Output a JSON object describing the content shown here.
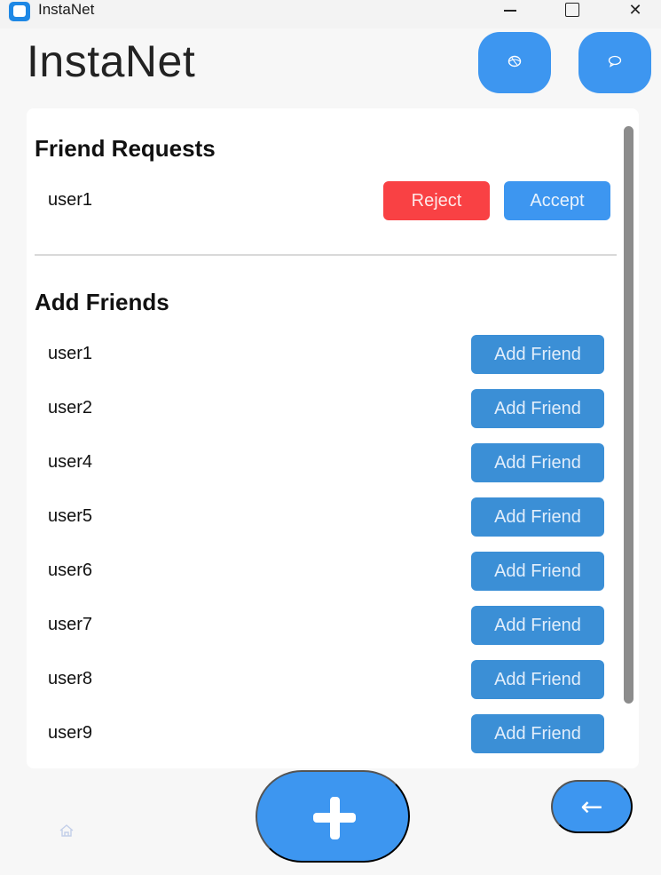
{
  "window": {
    "title": "InstaNet",
    "minimize_icon": "minimize-icon",
    "maximize_icon": "maximize-icon",
    "close_glyph": "✕"
  },
  "header": {
    "title": "InstaNet",
    "globe_button_icon": "globe-icon",
    "chat_button_icon": "chat-bubble-icon"
  },
  "friend_requests": {
    "title": "Friend Requests",
    "items": [
      {
        "user": "user1",
        "reject_label": "Reject",
        "accept_label": "Accept"
      }
    ]
  },
  "add_friends": {
    "title": "Add Friends",
    "button_label": "Add Friend",
    "items": [
      {
        "user": "user1",
        "button_label": "Add Friend"
      },
      {
        "user": "user2",
        "button_label": "Add Friend"
      },
      {
        "user": "user4",
        "button_label": "Add Friend"
      },
      {
        "user": "user5",
        "button_label": "Add Friend"
      },
      {
        "user": "user6",
        "button_label": "Add Friend"
      },
      {
        "user": "user7",
        "button_label": "Add Friend"
      },
      {
        "user": "user8",
        "button_label": "Add Friend"
      },
      {
        "user": "user9",
        "button_label": "Add Friend"
      }
    ]
  },
  "bottom": {
    "add_icon": "plus-icon",
    "back_glyph": "←",
    "home_icon": "home-icon"
  },
  "colors": {
    "primary": "#3d96f0",
    "reject": "#f94144",
    "add_friend": "#3b8fd6"
  }
}
